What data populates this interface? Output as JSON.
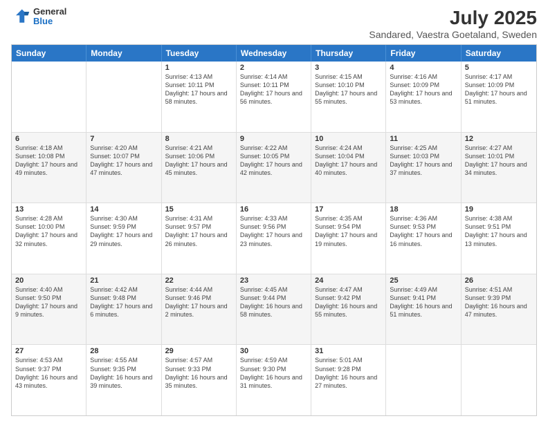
{
  "header": {
    "logo": {
      "general": "General",
      "blue": "Blue"
    },
    "title": "July 2025",
    "subtitle": "Sandared, Vaestra Goetaland, Sweden"
  },
  "calendar": {
    "days_of_week": [
      "Sunday",
      "Monday",
      "Tuesday",
      "Wednesday",
      "Thursday",
      "Friday",
      "Saturday"
    ],
    "weeks": [
      [
        {
          "day": "",
          "info": ""
        },
        {
          "day": "",
          "info": ""
        },
        {
          "day": "1",
          "info": "Sunrise: 4:13 AM\nSunset: 10:11 PM\nDaylight: 17 hours and 58 minutes."
        },
        {
          "day": "2",
          "info": "Sunrise: 4:14 AM\nSunset: 10:11 PM\nDaylight: 17 hours and 56 minutes."
        },
        {
          "day": "3",
          "info": "Sunrise: 4:15 AM\nSunset: 10:10 PM\nDaylight: 17 hours and 55 minutes."
        },
        {
          "day": "4",
          "info": "Sunrise: 4:16 AM\nSunset: 10:09 PM\nDaylight: 17 hours and 53 minutes."
        },
        {
          "day": "5",
          "info": "Sunrise: 4:17 AM\nSunset: 10:09 PM\nDaylight: 17 hours and 51 minutes."
        }
      ],
      [
        {
          "day": "6",
          "info": "Sunrise: 4:18 AM\nSunset: 10:08 PM\nDaylight: 17 hours and 49 minutes."
        },
        {
          "day": "7",
          "info": "Sunrise: 4:20 AM\nSunset: 10:07 PM\nDaylight: 17 hours and 47 minutes."
        },
        {
          "day": "8",
          "info": "Sunrise: 4:21 AM\nSunset: 10:06 PM\nDaylight: 17 hours and 45 minutes."
        },
        {
          "day": "9",
          "info": "Sunrise: 4:22 AM\nSunset: 10:05 PM\nDaylight: 17 hours and 42 minutes."
        },
        {
          "day": "10",
          "info": "Sunrise: 4:24 AM\nSunset: 10:04 PM\nDaylight: 17 hours and 40 minutes."
        },
        {
          "day": "11",
          "info": "Sunrise: 4:25 AM\nSunset: 10:03 PM\nDaylight: 17 hours and 37 minutes."
        },
        {
          "day": "12",
          "info": "Sunrise: 4:27 AM\nSunset: 10:01 PM\nDaylight: 17 hours and 34 minutes."
        }
      ],
      [
        {
          "day": "13",
          "info": "Sunrise: 4:28 AM\nSunset: 10:00 PM\nDaylight: 17 hours and 32 minutes."
        },
        {
          "day": "14",
          "info": "Sunrise: 4:30 AM\nSunset: 9:59 PM\nDaylight: 17 hours and 29 minutes."
        },
        {
          "day": "15",
          "info": "Sunrise: 4:31 AM\nSunset: 9:57 PM\nDaylight: 17 hours and 26 minutes."
        },
        {
          "day": "16",
          "info": "Sunrise: 4:33 AM\nSunset: 9:56 PM\nDaylight: 17 hours and 23 minutes."
        },
        {
          "day": "17",
          "info": "Sunrise: 4:35 AM\nSunset: 9:54 PM\nDaylight: 17 hours and 19 minutes."
        },
        {
          "day": "18",
          "info": "Sunrise: 4:36 AM\nSunset: 9:53 PM\nDaylight: 17 hours and 16 minutes."
        },
        {
          "day": "19",
          "info": "Sunrise: 4:38 AM\nSunset: 9:51 PM\nDaylight: 17 hours and 13 minutes."
        }
      ],
      [
        {
          "day": "20",
          "info": "Sunrise: 4:40 AM\nSunset: 9:50 PM\nDaylight: 17 hours and 9 minutes."
        },
        {
          "day": "21",
          "info": "Sunrise: 4:42 AM\nSunset: 9:48 PM\nDaylight: 17 hours and 6 minutes."
        },
        {
          "day": "22",
          "info": "Sunrise: 4:44 AM\nSunset: 9:46 PM\nDaylight: 17 hours and 2 minutes."
        },
        {
          "day": "23",
          "info": "Sunrise: 4:45 AM\nSunset: 9:44 PM\nDaylight: 16 hours and 58 minutes."
        },
        {
          "day": "24",
          "info": "Sunrise: 4:47 AM\nSunset: 9:42 PM\nDaylight: 16 hours and 55 minutes."
        },
        {
          "day": "25",
          "info": "Sunrise: 4:49 AM\nSunset: 9:41 PM\nDaylight: 16 hours and 51 minutes."
        },
        {
          "day": "26",
          "info": "Sunrise: 4:51 AM\nSunset: 9:39 PM\nDaylight: 16 hours and 47 minutes."
        }
      ],
      [
        {
          "day": "27",
          "info": "Sunrise: 4:53 AM\nSunset: 9:37 PM\nDaylight: 16 hours and 43 minutes."
        },
        {
          "day": "28",
          "info": "Sunrise: 4:55 AM\nSunset: 9:35 PM\nDaylight: 16 hours and 39 minutes."
        },
        {
          "day": "29",
          "info": "Sunrise: 4:57 AM\nSunset: 9:33 PM\nDaylight: 16 hours and 35 minutes."
        },
        {
          "day": "30",
          "info": "Sunrise: 4:59 AM\nSunset: 9:30 PM\nDaylight: 16 hours and 31 minutes."
        },
        {
          "day": "31",
          "info": "Sunrise: 5:01 AM\nSunset: 9:28 PM\nDaylight: 16 hours and 27 minutes."
        },
        {
          "day": "",
          "info": ""
        },
        {
          "day": "",
          "info": ""
        }
      ]
    ]
  }
}
